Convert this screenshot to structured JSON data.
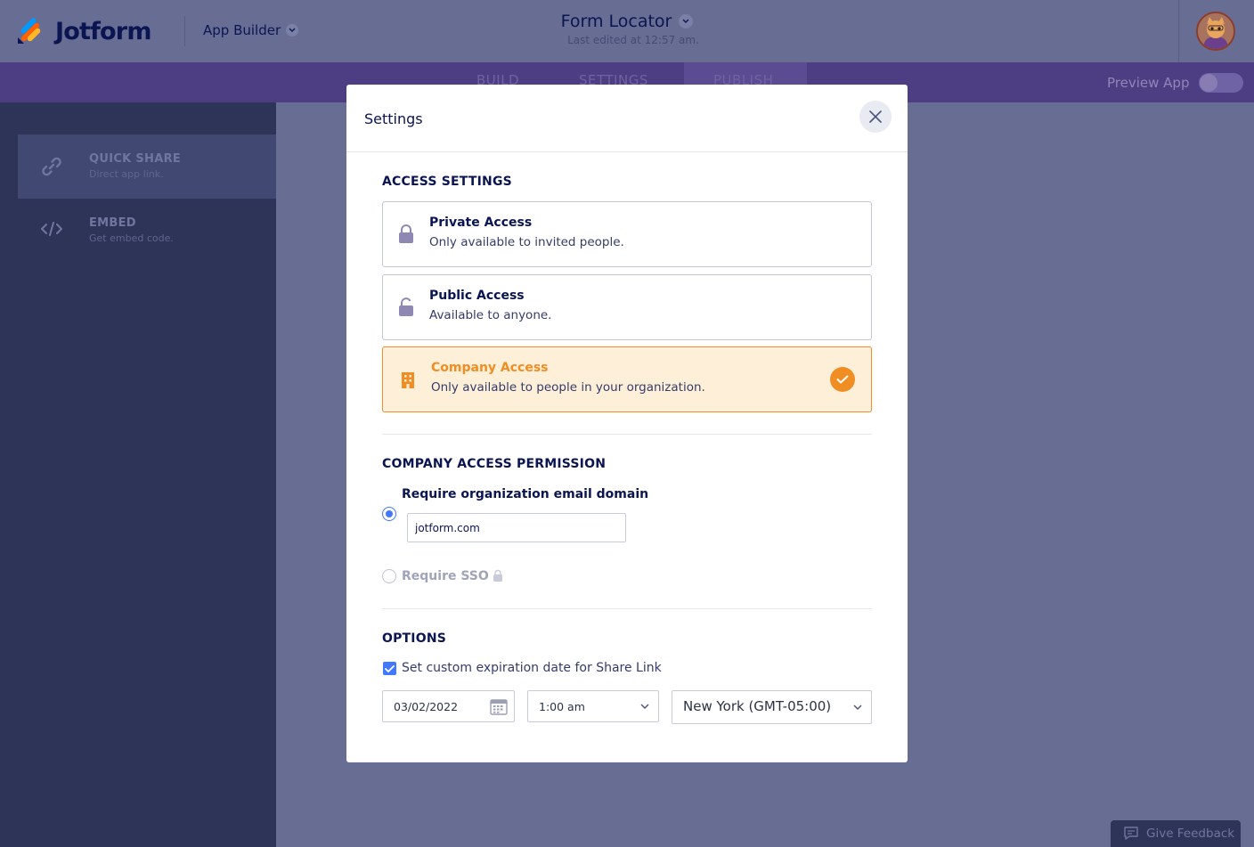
{
  "header": {
    "brand": "Jotform",
    "app_builder": "App Builder",
    "form_title": "Form Locator",
    "last_edited": "Last edited at 12:57 am."
  },
  "nav": {
    "tabs": [
      {
        "label": "BUILD"
      },
      {
        "label": "SETTINGS"
      },
      {
        "label": "PUBLISH"
      }
    ],
    "preview_label": "Preview App"
  },
  "sidebar": {
    "items": [
      {
        "title": "QUICK SHARE",
        "subtitle": "Direct app link."
      },
      {
        "title": "EMBED",
        "subtitle": "Get embed code."
      }
    ]
  },
  "modal": {
    "title": "Settings",
    "access_heading": "ACCESS SETTINGS",
    "access_options": [
      {
        "title": "Private Access",
        "desc": "Only available to invited people.",
        "icon": "lock-icon"
      },
      {
        "title": "Public Access",
        "desc": "Available to anyone.",
        "icon": "unlock-icon"
      },
      {
        "title": "Company Access",
        "desc": "Only available to people in your organization.",
        "icon": "building-icon",
        "selected": true
      }
    ],
    "permission_heading": "COMPANY ACCESS PERMISSION",
    "require_domain_label": "Require organization email domain",
    "domain_value": "jotform.com",
    "require_sso_label": "Require SSO",
    "options_heading": "OPTIONS",
    "expiration_label": "Set custom expiration date for Share Link",
    "date_value": "03/02/2022",
    "time_value": "1:00 am",
    "timezone_value": "New York (GMT-05:00)"
  },
  "feedback": {
    "label": "Give Feedback"
  },
  "colors": {
    "accent_orange": "#f08e23",
    "accent_blue": "#4277ff",
    "navy": "#0a1551",
    "nav_purple": "#4d3d82"
  }
}
